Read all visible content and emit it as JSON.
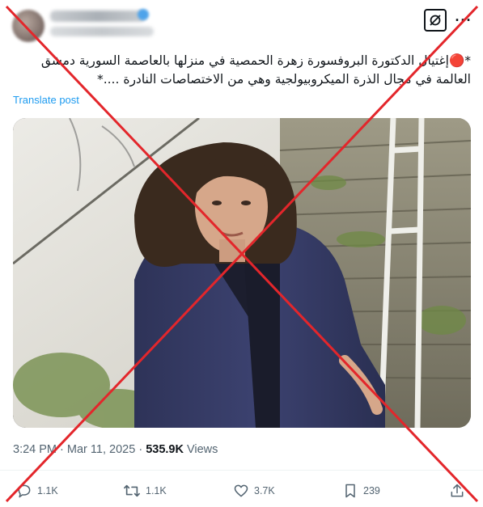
{
  "post": {
    "text": "*🔴إغتيال الدكتورة البروفسورة زهرة الحمصية في منزلها بالعاصمة السورية دمشق العالمة في مجال الذرة الميكروبيولجية وهي من الاختصاصات النادرة ....*",
    "translate_label": "Translate post",
    "time": "3:24 PM",
    "separator": "·",
    "date": "Mar 11, 2025",
    "views_count": "535.9K",
    "views_label": "Views"
  },
  "actions": {
    "replies": "1.1K",
    "reposts": "1.1K",
    "likes": "3.7K",
    "bookmarks": "239"
  },
  "icons": {
    "grok": "grok-icon",
    "more": "more-icon",
    "reply": "reply-icon",
    "repost": "repost-icon",
    "like": "heart-icon",
    "bookmark": "bookmark-icon",
    "share": "share-icon"
  },
  "colors": {
    "link": "#1d9bf0",
    "secondary_text": "#536471",
    "primary_text": "#0f1419",
    "overlay_cross": "#e3262b"
  }
}
